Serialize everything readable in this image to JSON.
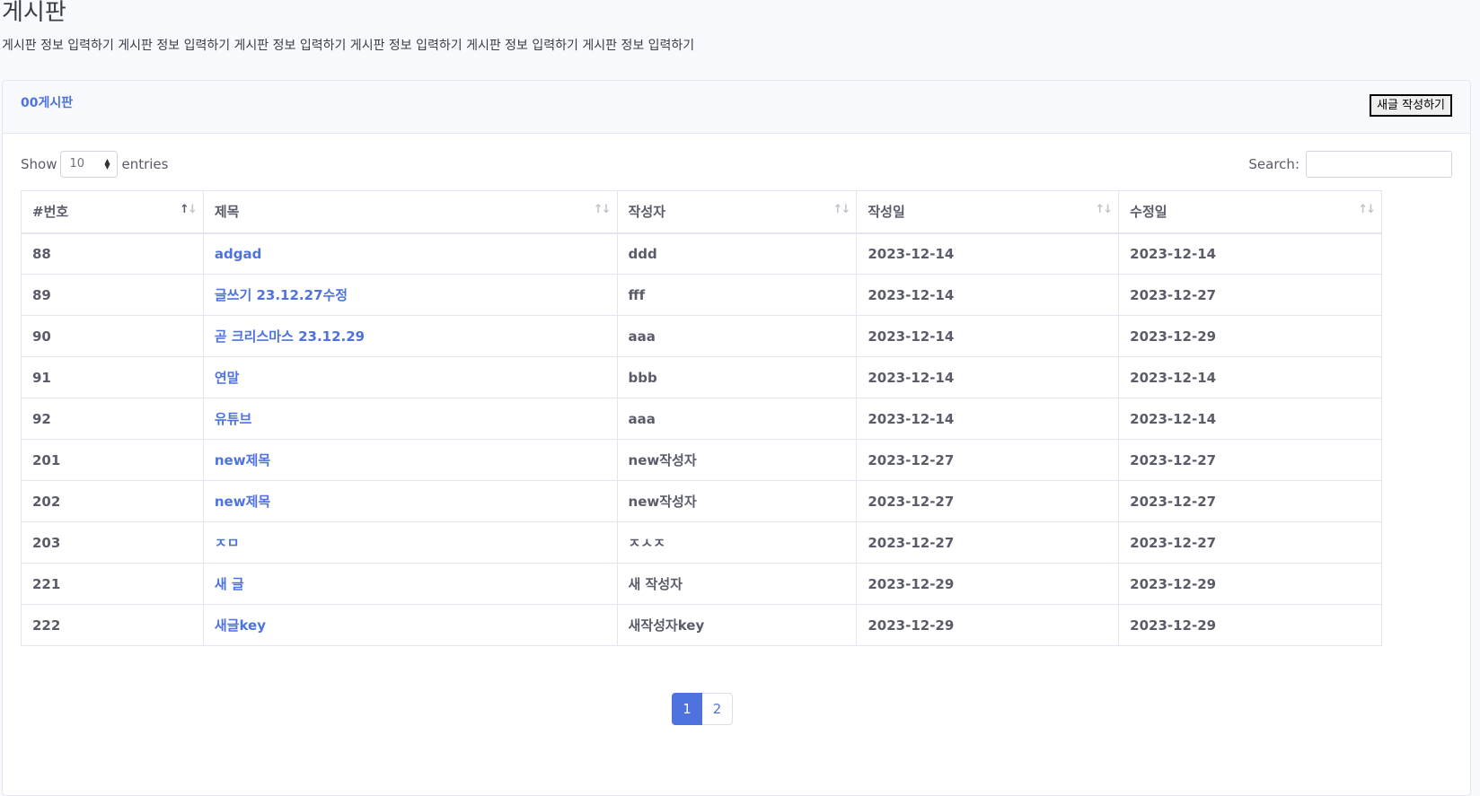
{
  "page": {
    "title": "게시판",
    "description": "게시판 정보 입력하기 게시판 정보 입력하기 게시판 정보 입력하기 게시판 정보 입력하기 게시판 정보 입력하기 게시판 정보 입력하기"
  },
  "card": {
    "title": "00게시판",
    "write_button_label": "새글 작성하기"
  },
  "length": {
    "prefix": "Show",
    "value": "10",
    "suffix": "entries"
  },
  "search": {
    "label": "Search:",
    "value": "",
    "placeholder": ""
  },
  "table": {
    "headers": [
      "#번호",
      "제목",
      "작성자",
      "작성일",
      "수정일"
    ],
    "rows": [
      {
        "no": "88",
        "title": "adgad",
        "writer": "ddd",
        "created": "2023-12-14",
        "updated": "2023-12-14"
      },
      {
        "no": "89",
        "title": "글쓰기 23.12.27수정",
        "writer": "fff",
        "created": "2023-12-14",
        "updated": "2023-12-27"
      },
      {
        "no": "90",
        "title": "곧 크리스마스 23.12.29",
        "writer": "aaa",
        "created": "2023-12-14",
        "updated": "2023-12-29"
      },
      {
        "no": "91",
        "title": "연말",
        "writer": "bbb",
        "created": "2023-12-14",
        "updated": "2023-12-14"
      },
      {
        "no": "92",
        "title": "유튜브",
        "writer": "aaa",
        "created": "2023-12-14",
        "updated": "2023-12-14"
      },
      {
        "no": "201",
        "title": "new제목",
        "writer": "new작성자",
        "created": "2023-12-27",
        "updated": "2023-12-27"
      },
      {
        "no": "202",
        "title": "new제목",
        "writer": "new작성자",
        "created": "2023-12-27",
        "updated": "2023-12-27"
      },
      {
        "no": "203",
        "title": "ㅈㅁ",
        "writer": "ㅈㅅㅈ",
        "created": "2023-12-27",
        "updated": "2023-12-27"
      },
      {
        "no": "221",
        "title": "새 글",
        "writer": "새 작성자",
        "created": "2023-12-29",
        "updated": "2023-12-29"
      },
      {
        "no": "222",
        "title": "새글key",
        "writer": "새작성자key",
        "created": "2023-12-29",
        "updated": "2023-12-29"
      }
    ]
  },
  "pagination": {
    "pages": [
      "1",
      "2"
    ],
    "active": "1"
  },
  "colors": {
    "primary": "#4e73df",
    "text": "#5a5c69",
    "border": "#e3e6f0",
    "background": "#f8f9fc"
  },
  "icons": {
    "sort": "sort-arrows-icon",
    "select": "select-arrows-icon"
  }
}
